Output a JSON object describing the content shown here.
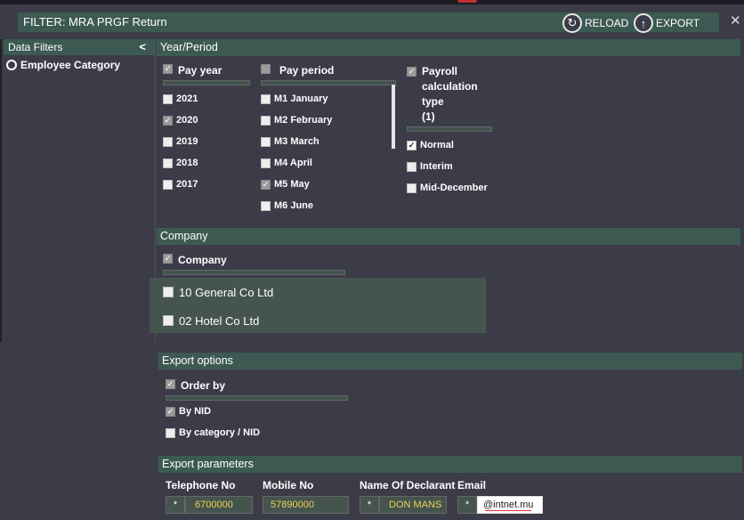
{
  "title": "FILTER: MRA PRGF Return",
  "toolbar": {
    "reload_label": "RELOAD",
    "export_label": "EXPORT",
    "close_glyph": "✕"
  },
  "sidebar": {
    "title": "Data Filters",
    "items": [
      {
        "label": "Employee Category"
      }
    ]
  },
  "year_period": {
    "section_title": "Year/Period",
    "pay_year": {
      "title": "Pay year",
      "options": [
        {
          "label": "2021",
          "checked": false
        },
        {
          "label": "2020",
          "checked": true
        },
        {
          "label": "2019",
          "checked": false
        },
        {
          "label": "2018",
          "checked": false
        },
        {
          "label": "2017",
          "checked": false
        }
      ]
    },
    "pay_period": {
      "title": "Pay period",
      "options": [
        {
          "label": "M1 January",
          "checked": false
        },
        {
          "label": "M2 February",
          "checked": false
        },
        {
          "label": "M3 March",
          "checked": false
        },
        {
          "label": "M4 April",
          "checked": false
        },
        {
          "label": "M5 May",
          "checked": true
        },
        {
          "label": "M6 June",
          "checked": false
        }
      ]
    },
    "calc_type": {
      "title_line1": "Payroll",
      "title_line2": "calculation type",
      "title_line3": "(1)",
      "options": [
        {
          "label": "Normal",
          "checked": true
        },
        {
          "label": "Interim",
          "checked": false
        },
        {
          "label": "Mid-December",
          "checked": false
        }
      ]
    }
  },
  "company": {
    "section_title": "Company",
    "header": "Company",
    "options": [
      {
        "label": "10 General Co Ltd",
        "checked": false
      },
      {
        "label": "02 Hotel Co Ltd",
        "checked": false
      }
    ]
  },
  "export_options": {
    "section_title": "Export options",
    "header": "Order by",
    "options": [
      {
        "label": "By NID",
        "checked": true
      },
      {
        "label": "By category / NID",
        "checked": false
      }
    ]
  },
  "export_parameters": {
    "section_title": "Export parameters",
    "telephone_label": "Telephone No",
    "telephone_value": "6700000",
    "mobile_label": "Mobile No",
    "mobile_value": "57890000",
    "declarant_label": "Name Of Declarant",
    "declarant_value": "DON MANS",
    "email_label": "Email",
    "email_value": "@intnet.mu",
    "required_mark": "*"
  },
  "colors": {
    "background": "#3b3c48",
    "section_header": "#3c5a52",
    "value_text": "#e8d44d"
  }
}
